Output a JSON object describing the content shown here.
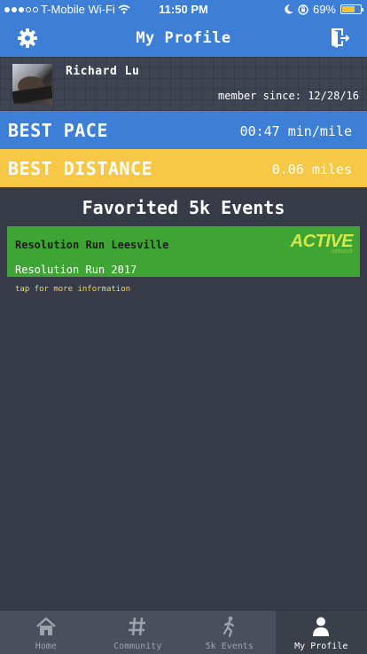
{
  "status_bar": {
    "carrier": "T-Mobile Wi-Fi",
    "time": "11:50 PM",
    "battery_percent": "69%",
    "battery_level": 0.69
  },
  "header": {
    "title": "My Profile",
    "settings_icon": "gear-icon",
    "logout_icon": "logout-door-icon"
  },
  "profile": {
    "name": "Richard Lu",
    "member_since": "member since: 12/28/16"
  },
  "stats": {
    "best_pace_label": "BEST PACE",
    "best_pace_value": "00:47 min/mile",
    "best_distance_label": "BEST DISTANCE",
    "best_distance_value": "0.06 miles"
  },
  "favorites": {
    "title": "Favorited 5k Events",
    "events": [
      {
        "name": "Resolution Run Leesville",
        "subtitle": "Resolution Run 2017",
        "hint": "tap for more information",
        "logo_text": "ACTIVE",
        "logo_sub": "network"
      }
    ]
  },
  "tabbar": {
    "tabs": [
      {
        "label": "Home",
        "icon": "home-icon"
      },
      {
        "label": "Community",
        "icon": "hash-icon"
      },
      {
        "label": "5k Events",
        "icon": "runner-icon"
      },
      {
        "label": "My Profile",
        "icon": "person-icon"
      }
    ],
    "active": "My Profile"
  },
  "colors": {
    "header_blue": "#3d7fd6",
    "distance_yellow": "#f7c845",
    "event_green": "#3ea535",
    "background": "#363b47"
  }
}
